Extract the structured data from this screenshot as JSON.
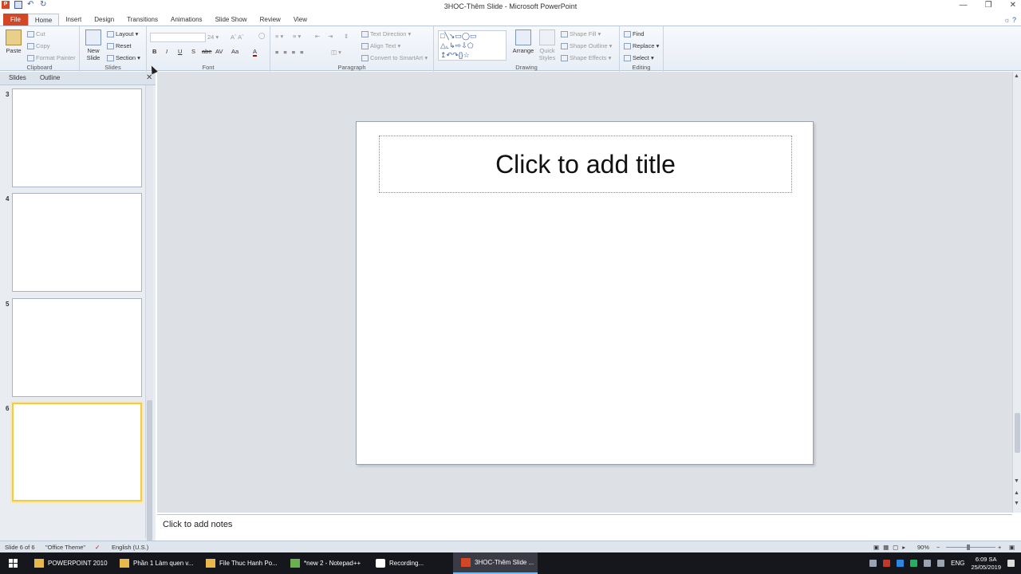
{
  "window": {
    "title": "3HOC-Thêm Slide  -  Microsoft PowerPoint",
    "controls": [
      "—",
      "❐",
      "✕"
    ]
  },
  "ribbon_tabs": [
    "File",
    "Home",
    "Insert",
    "Design",
    "Transitions",
    "Animations",
    "Slide Show",
    "Review",
    "View"
  ],
  "clipboard": {
    "label": "Clipboard",
    "paste": "Paste",
    "cut": "Cut",
    "copy": "Copy",
    "format_painter": "Format Painter"
  },
  "slides_group": {
    "label": "Slides",
    "new_slide_line1": "New",
    "new_slide_line2": "Slide",
    "layout": "Layout",
    "reset": "Reset",
    "section": "Section"
  },
  "font_group": {
    "label": "Font",
    "size": "24",
    "bold": "B",
    "italic": "I",
    "underline": "U",
    "strike": "S",
    "abc": "abe",
    "av": "AV",
    "aa": "Aa",
    "color": "A"
  },
  "paragraph_group": {
    "label": "Paragraph",
    "text_direction": "Text Direction",
    "align_text": "Align Text",
    "convert_smartart": "Convert to SmartArt"
  },
  "drawing_group": {
    "label": "Drawing",
    "arrange": "Arrange",
    "quick_styles_line1": "Quick",
    "quick_styles_line2": "Styles",
    "shape_fill": "Shape Fill",
    "shape_outline": "Shape Outline",
    "shape_effects": "Shape Effects"
  },
  "editing_group": {
    "label": "Editing",
    "find": "Find",
    "replace": "Replace",
    "select": "Select"
  },
  "left_pane": {
    "tab_slides": "Slides",
    "tab_outline": "Outline",
    "close": "✕",
    "thumbnails": [
      "3",
      "4",
      "5",
      "6"
    ],
    "selected": "6"
  },
  "slide": {
    "title_placeholder": "Click to add title"
  },
  "notes": {
    "placeholder": "Click to add notes"
  },
  "status": {
    "slide_count": "Slide 6 of 6",
    "theme": "\"Office Theme\"",
    "language": "English (U.S.)",
    "zoom": "90%",
    "zoom_level": 0.45
  },
  "taskbar": {
    "items": [
      "POWERPOINT 2010",
      "Phần 1 Làm quen v...",
      "File Thuc Hanh Po...",
      "*new 2 - Notepad++",
      "Recording...",
      "3HOC-Thêm Slide ..."
    ],
    "input_lang": "ENG",
    "time": "6:09 SA",
    "date": "25/05/2019"
  }
}
